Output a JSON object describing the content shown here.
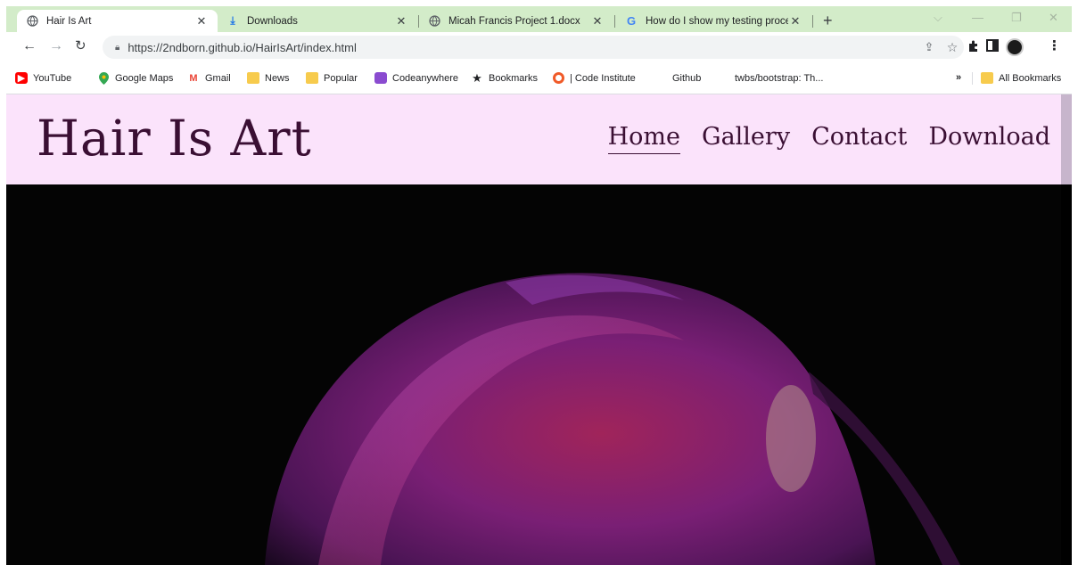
{
  "tabs": [
    {
      "title": "Hair Is Art",
      "icon": "globe-icon",
      "active": true
    },
    {
      "title": "Downloads",
      "icon": "download-icon",
      "active": false
    },
    {
      "title": "Micah Francis Project 1.docx",
      "icon": "globe-icon",
      "active": false
    },
    {
      "title": "How do I show my testing proce",
      "icon": "google-icon",
      "active": false
    }
  ],
  "toolbar": {
    "url": "https://2ndborn.github.io/HairIsArt/index.html"
  },
  "bookmarks": [
    {
      "label": "YouTube",
      "icon": "youtube-icon"
    },
    {
      "label": "Google Maps",
      "icon": "maps-pin-icon"
    },
    {
      "label": "Gmail",
      "icon": "gmail-icon"
    },
    {
      "label": "News",
      "icon": "folder-icon"
    },
    {
      "label": "Popular",
      "icon": "folder-icon"
    },
    {
      "label": "Codeanywhere",
      "icon": "codeanywhere-icon"
    },
    {
      "label": "Bookmarks",
      "icon": "star-icon"
    },
    {
      "label": "| Code Institute",
      "icon": "code-institute-icon"
    },
    {
      "label": "Github",
      "icon": "blank-icon"
    },
    {
      "label": "twbs/bootstrap: Th...",
      "icon": "blank-icon"
    }
  ],
  "bookmarks_more": "»",
  "all_bookmarks": "All Bookmarks",
  "site": {
    "brand": "Hair Is Art",
    "nav": [
      "Home",
      "Gallery",
      "Contact",
      "Download"
    ],
    "active_nav": "Home"
  },
  "colors": {
    "header_bg": "#fbe3fb",
    "brand_text": "#3a0f33",
    "tabstrip_bg": "#d3ecc9"
  }
}
